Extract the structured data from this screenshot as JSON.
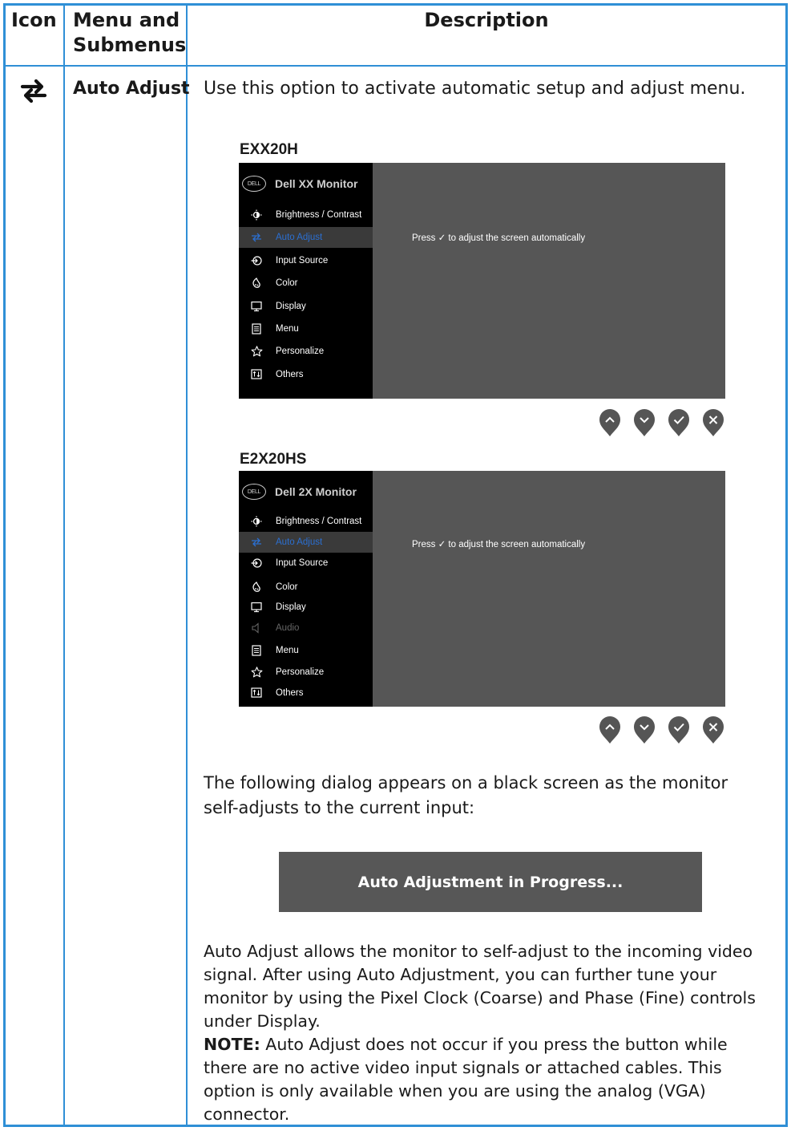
{
  "header": {
    "icon": "Icon",
    "menu": "Menu and Submenus",
    "description": "Description"
  },
  "row": {
    "icon": "auto-adjust-arrows-icon",
    "menu": "Auto Adjust",
    "intro": "Use this option to activate automatic setup and adjust menu."
  },
  "osd1": {
    "model": "EXX20H",
    "logo": "DELL",
    "title": "Dell XX Monitor",
    "items": [
      {
        "label": "Brightness / Contrast",
        "icon": "brightness-icon"
      },
      {
        "label": "Auto Adjust",
        "icon": "auto-adjust-icon",
        "selected": true
      },
      {
        "label": "Input Source",
        "icon": "input-source-icon"
      },
      {
        "label": "Color",
        "icon": "color-palette-icon"
      },
      {
        "label": "Display",
        "icon": "display-icon"
      },
      {
        "label": "Menu",
        "icon": "menu-icon"
      },
      {
        "label": "Personalize",
        "icon": "star-icon"
      },
      {
        "label": "Others",
        "icon": "others-icon"
      }
    ],
    "message": "Press ✓ to adjust the screen automatically"
  },
  "osd2": {
    "model": "E2X20HS",
    "logo": "DELL",
    "title": "Dell 2X Monitor",
    "items": [
      {
        "label": "Brightness / Contrast",
        "icon": "brightness-icon"
      },
      {
        "label": "Auto Adjust",
        "icon": "auto-adjust-icon",
        "selected": true
      },
      {
        "label": "Input Source",
        "icon": "input-source-icon"
      },
      {
        "label": "Color",
        "icon": "color-palette-icon"
      },
      {
        "label": "Display",
        "icon": "display-icon"
      },
      {
        "label": "Audio",
        "icon": "speaker-icon",
        "disabled": true
      },
      {
        "label": "Menu",
        "icon": "menu-icon"
      },
      {
        "label": "Personalize",
        "icon": "star-icon"
      },
      {
        "label": "Others",
        "icon": "others-icon"
      }
    ],
    "message": "Press ✓ to adjust the screen automatically"
  },
  "buttons": [
    "up-button",
    "down-button",
    "confirm-button",
    "close-button"
  ],
  "dialog_intro": "The following dialog appears on a black screen as the monitor self-adjusts to the current input:",
  "dialog_text": "Auto Adjustment in Progress...",
  "body_text": "Auto Adjust allows the monitor to self-adjust to the incoming video signal. After using Auto Adjustment, you can further tune your monitor by using the Pixel Clock (Coarse) and Phase (Fine) controls under Display.",
  "note_label": "NOTE:",
  "note_text": " Auto Adjust does not occur if you press the button while there are no active video input signals or attached cables. This option is only available when you are using the analog (VGA) connector.",
  "colors": {
    "border": "#2f8fd6",
    "osd_bg": "#565656",
    "selected_text": "#2b6fd1"
  }
}
